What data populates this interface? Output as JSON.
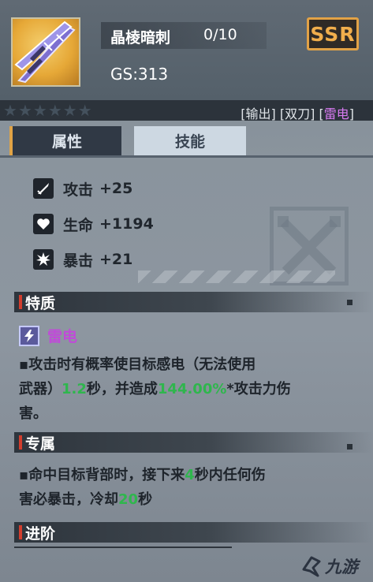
{
  "item": {
    "name": "晶棱暗刺",
    "level": "0/10",
    "gs": "GS:313",
    "rarity": "SSR",
    "star_count": 6,
    "tags": {
      "open_output": "[输出]",
      "open_dual": "[双刀]",
      "thunder_prefix": "[",
      "thunder": "雷电",
      "thunder_suffix": "]"
    }
  },
  "tabs": {
    "attributes": "属性",
    "skills": "技能",
    "active": "属性"
  },
  "stats": [
    {
      "icon": "sword-icon",
      "label": "攻击",
      "value": "+25"
    },
    {
      "icon": "heart-icon",
      "label": "生命",
      "value": "+1194"
    },
    {
      "icon": "burst-icon",
      "label": "暴击",
      "value": "+21"
    }
  ],
  "sections": {
    "trait": {
      "title": "特质",
      "name": "雷电",
      "icon": "lightning-icon",
      "desc_a": "▪攻击时有概率使目标感电（无法使用",
      "desc_b": "武器）",
      "desc_v1": "1.2",
      "desc_c": "秒，并造成",
      "desc_v2": "144.00%",
      "desc_d": "*攻击力伤",
      "desc_e": "害。"
    },
    "exclusive": {
      "title": "专属",
      "desc_a": "▪命中目标背部时，接下来",
      "desc_v1": "4",
      "desc_b": "秒内任何伤",
      "desc_c": "害必暴击，冷却",
      "desc_v2": "20",
      "desc_d": "秒"
    },
    "advance": {
      "title": "进阶"
    }
  },
  "watermark": {
    "text": "九游"
  },
  "colors": {
    "accent": "#e1a446",
    "rarity": "#f1ae4c",
    "thunder": "#c04bd8",
    "highlight": "#2fb64d",
    "section_marker": "#d23d2d"
  }
}
